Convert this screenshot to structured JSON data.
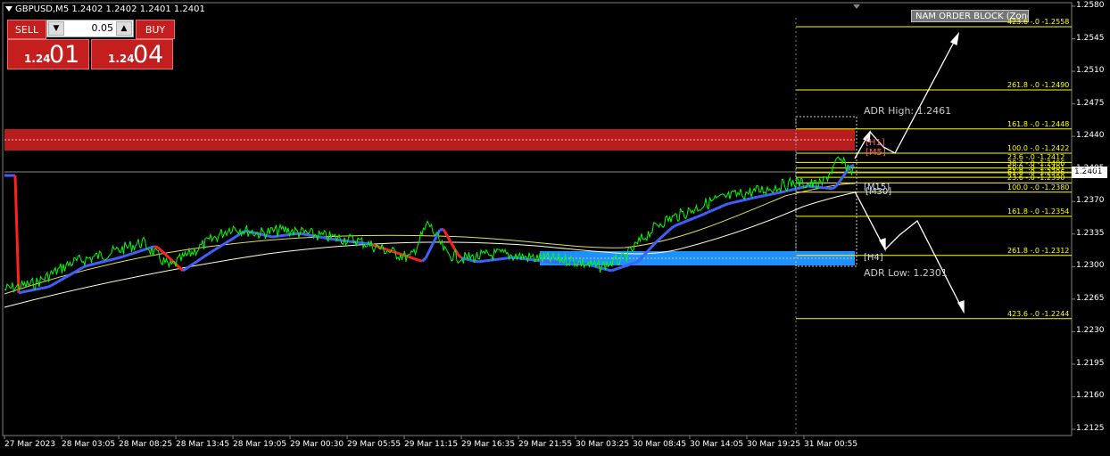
{
  "symbol_header": "GBPUSD,M5  1.2402 1.2402 1.2401 1.2401",
  "trade_panel": {
    "sell_label": "SELL",
    "buy_label": "BUY",
    "lot_value": "0.05",
    "down_symbol": "▼",
    "up_symbol": "▲",
    "sell_price_small": "1.24",
    "sell_price_big": "01",
    "buy_price_small": "1.24",
    "buy_price_big": "04"
  },
  "indicator_label": "NAM ORDER BLOCK (Zones)",
  "current_price": "1.2401",
  "y_axis_labels": [
    "1.2580",
    "1.2545",
    "1.2510",
    "1.2475",
    "1.2440",
    "1.2405",
    "1.2370",
    "1.2335",
    "1.2300",
    "1.2265",
    "1.2230",
    "1.2195",
    "1.2160",
    "1.2125"
  ],
  "x_axis_labels": [
    "27 Mar 2023",
    "28 Mar 03:05",
    "28 Mar 08:25",
    "28 Mar 13:45",
    "28 Mar 19:05",
    "29 Mar 00:30",
    "29 Mar 05:55",
    "29 Mar 11:15",
    "29 Mar 16:35",
    "29 Mar 21:55",
    "30 Mar 03:25",
    "30 Mar 08:45",
    "30 Mar 14:05",
    "30 Mar 19:25",
    "31 Mar 00:55"
  ],
  "fib_levels": [
    {
      "text": "423.6 -.0 -1.2558",
      "price": 1.2558
    },
    {
      "text": "261.8 -.0 -1.2490",
      "price": 1.249
    },
    {
      "text": "161.8 -.0 -1.2448",
      "price": 1.2448
    },
    {
      "text": "100.0 -.0 -1.2422",
      "price": 1.2422
    },
    {
      "text": "23.6 -.0 -1.2412",
      "price": 1.2412
    },
    {
      "text": "38.2 -.0 -1.2406",
      "price": 1.2406
    },
    {
      "text": "50.0 -.0 -1.2401",
      "price": 1.2401
    },
    {
      "text": "61.8 -.0 -1.2396",
      "price": 1.2396
    },
    {
      "text": "23.6 -.0 -1.2390",
      "price": 1.239
    },
    {
      "text": "100.0 -.0 -1.2380",
      "price": 1.238
    },
    {
      "text": "161.8 -.0 -1.2354",
      "price": 1.2354
    },
    {
      "text": "261.8 -.0 -1.2312",
      "price": 1.2312
    },
    {
      "text": "423.6 -.0 -1.2244",
      "price": 1.2244
    }
  ],
  "adr_high_label": "ADR High: 1.2461",
  "adr_low_label": "ADR Low: 1.2301",
  "tags": {
    "h1": "[H1]",
    "m5": "[M5]",
    "m30": "[M30]",
    "m15": "[M15]",
    "h4": "[H4]"
  },
  "colors": {
    "bull": "#00ff00",
    "supply_zone": "#d42020",
    "demand_zone": "#1e90ff",
    "fib": "#ffff00",
    "ma_fast": "#4060ff",
    "ma_red": "#ff2020"
  }
}
